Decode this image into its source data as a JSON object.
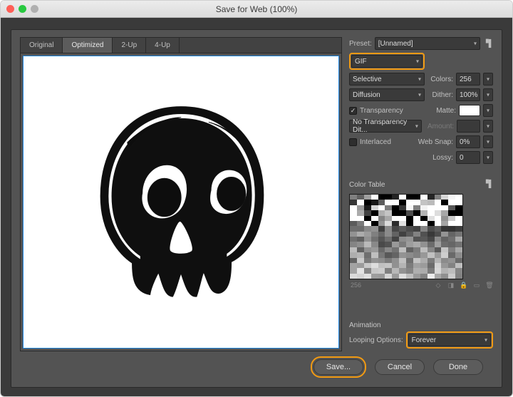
{
  "window": {
    "title": "Save for Web (100%)"
  },
  "tabs": {
    "items": [
      {
        "label": "Original"
      },
      {
        "label": "Optimized"
      },
      {
        "label": "2-Up"
      },
      {
        "label": "4-Up"
      }
    ],
    "active_index": 1
  },
  "settings": {
    "preset_label": "Preset:",
    "preset_value": "[Unnamed]",
    "format_value": "GIF",
    "reduction_value": "Selective",
    "dither_method_value": "Diffusion",
    "transparency_label": "Transparency",
    "transparency_checked": true,
    "trans_dither_value": "No Transparency Dit...",
    "interlaced_label": "Interlaced",
    "interlaced_checked": false,
    "colors_label": "Colors:",
    "colors_value": "256",
    "dither_label": "Dither:",
    "dither_value": "100%",
    "matte_label": "Matte:",
    "amount_label": "Amount:",
    "amount_value": "",
    "websnap_label": "Web Snap:",
    "websnap_value": "0%",
    "lossy_label": "Lossy:",
    "lossy_value": "0"
  },
  "color_table": {
    "title": "Color Table",
    "count": "256"
  },
  "animation": {
    "title": "Animation",
    "looping_label": "Looping Options:",
    "looping_value": "Forever"
  },
  "buttons": {
    "save": "Save...",
    "cancel": "Cancel",
    "done": "Done"
  },
  "colors": {
    "highlight": "#f19a13",
    "selection": "#2089e6"
  }
}
